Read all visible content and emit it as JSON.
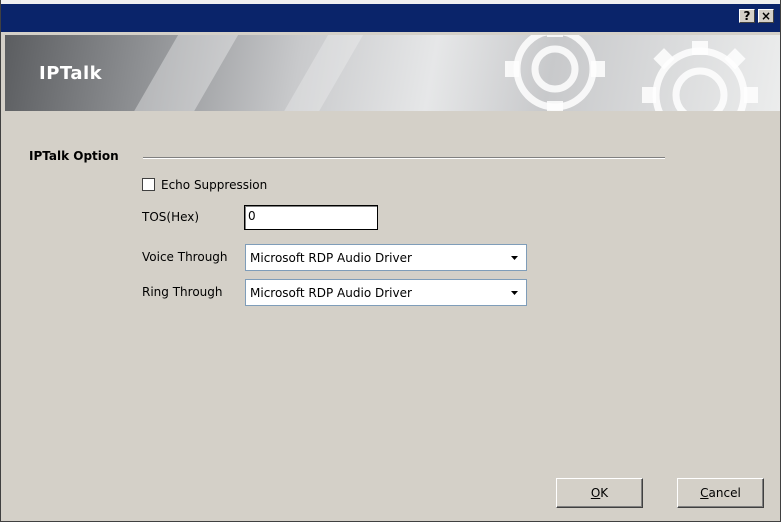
{
  "titlebar": {
    "help_label": "?",
    "close_label": "×"
  },
  "banner": {
    "title": "IPTalk"
  },
  "section": {
    "title": "IPTalk Option"
  },
  "options": {
    "echo_suppression": {
      "label": "Echo Suppression",
      "checked": false
    },
    "tos": {
      "label": "TOS(Hex)",
      "value": "0"
    },
    "voice_through": {
      "label": "Voice Through",
      "selected": "Microsoft RDP Audio Driver"
    },
    "ring_through": {
      "label": "Ring Through",
      "selected": "Microsoft RDP Audio Driver"
    }
  },
  "buttons": {
    "ok": {
      "mnemonic": "O",
      "rest": "K"
    },
    "cancel": {
      "mnemonic": "C",
      "rest": "ancel"
    }
  },
  "colors": {
    "titlebar": "#0a246a",
    "dialog_bg": "#d4d0c8",
    "banner_text": "#ffffff"
  }
}
